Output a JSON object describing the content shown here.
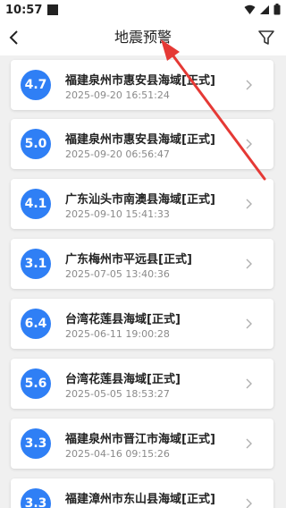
{
  "status_bar": {
    "time": "10:57",
    "icons": [
      "wifi-icon",
      "signal-icon",
      "battery-icon"
    ]
  },
  "header": {
    "title": "地震预警",
    "back_icon": "back-chevron-icon",
    "filter_icon": "filter-icon"
  },
  "colors": {
    "accent": "#2f7ff5",
    "annotation_arrow": "#e53935",
    "background": "#f0f0f0"
  },
  "list": [
    {
      "magnitude": "4.7",
      "place": "福建泉州市惠安县海域[正式]",
      "time": "2025-09-20 16:51:24"
    },
    {
      "magnitude": "5.0",
      "place": "福建泉州市惠安县海域[正式]",
      "time": "2025-09-20 06:56:47"
    },
    {
      "magnitude": "4.1",
      "place": "广东汕头市南澳县海域[正式]",
      "time": "2025-09-10 15:41:33"
    },
    {
      "magnitude": "3.1",
      "place": "广东梅州市平远县[正式]",
      "time": "2025-07-05 13:40:36"
    },
    {
      "magnitude": "6.4",
      "place": "台湾花莲县海域[正式]",
      "time": "2025-06-11 19:00:28"
    },
    {
      "magnitude": "5.6",
      "place": "台湾花莲县海域[正式]",
      "time": "2025-05-05 18:53:27"
    },
    {
      "magnitude": "3.3",
      "place": "福建泉州市晋江市海域[正式]",
      "time": "2025-04-16 09:15:26"
    },
    {
      "magnitude": "3.3",
      "place": "福建漳州市东山县海域[正式]",
      "time": ""
    }
  ]
}
